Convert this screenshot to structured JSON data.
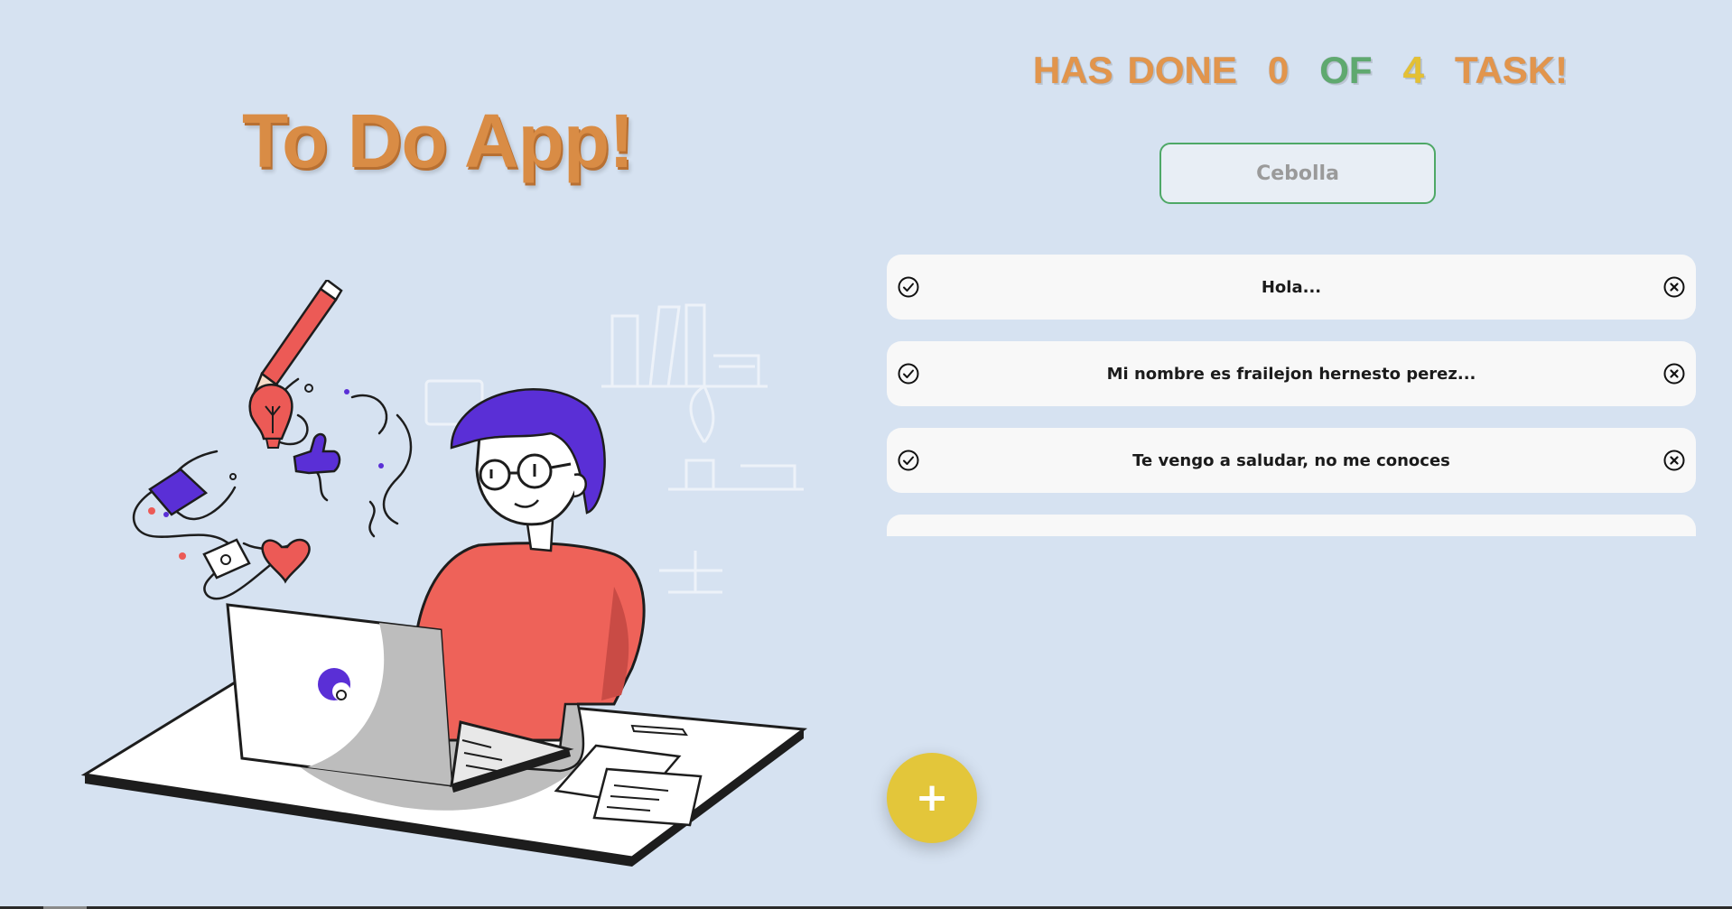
{
  "app": {
    "title": "To Do App!"
  },
  "counter": {
    "words": [
      "HAS",
      "DONE",
      "0",
      "OF",
      "4",
      "TASK!"
    ],
    "completed": 0,
    "total": 4
  },
  "search": {
    "placeholder": "Cebolla",
    "value": ""
  },
  "tasks": [
    {
      "text": "Hola...",
      "completed": false
    },
    {
      "text": "Mi nombre es frailejon hernesto perez...",
      "completed": false
    },
    {
      "text": "Te vengo a saludar, no me conoces",
      "completed": false
    },
    {
      "text": "",
      "completed": false
    }
  ],
  "add_button": {
    "label": "+"
  },
  "icons": {
    "check": "check-circle-icon",
    "delete": "x-circle-icon"
  },
  "colors": {
    "background": "#d6e2f1",
    "title": "#d98c45",
    "accent_green": "#4ea866",
    "accent_yellow": "#e3c63a",
    "person_shirt": "#ee6259",
    "person_hair": "#5a2fd6"
  }
}
